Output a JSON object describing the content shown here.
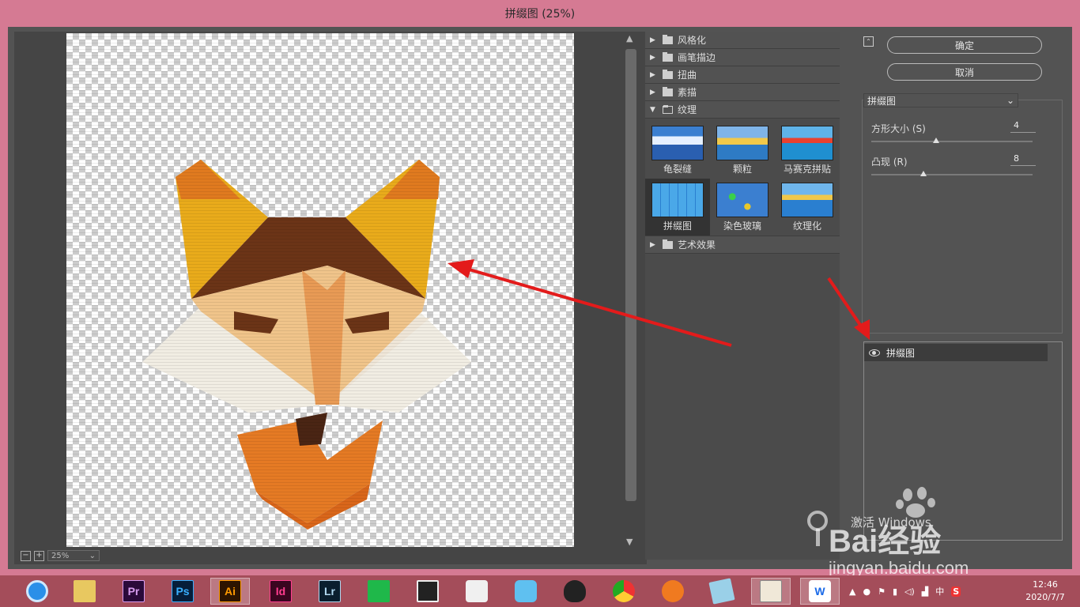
{
  "window": {
    "title": "拼缀图 (25%)"
  },
  "preview": {
    "zoom": "25%"
  },
  "gallery": {
    "categories_top": [
      {
        "label": "风格化",
        "expanded": false
      },
      {
        "label": "画笔描边",
        "expanded": false
      },
      {
        "label": "扭曲",
        "expanded": false
      },
      {
        "label": "素描",
        "expanded": false
      },
      {
        "label": "纹理",
        "expanded": true
      }
    ],
    "texture_thumbs": [
      {
        "label": "龟裂缝",
        "selected": false
      },
      {
        "label": "颗粒",
        "selected": false
      },
      {
        "label": "马赛克拼贴",
        "selected": false
      },
      {
        "label": "拼缀图",
        "selected": true
      },
      {
        "label": "染色玻璃",
        "selected": false
      },
      {
        "label": "纹理化",
        "selected": false
      }
    ],
    "category_bottom": {
      "label": "艺术效果",
      "expanded": false
    }
  },
  "panel": {
    "ok_label": "确定",
    "cancel_label": "取消",
    "filter_select": "拼缀图",
    "params": [
      {
        "label": "方形大小 (S)",
        "value": "4",
        "level": 0.4
      },
      {
        "label": "凸现 (R)",
        "value": "8",
        "level": 0.32
      }
    ],
    "layer_name": "拼缀图"
  },
  "watermark": {
    "activate": "激活 Windows",
    "brand": "Bai经验",
    "url": "jingyan.baidu.com"
  },
  "taskbar": {
    "apps": [
      "QQ浏览器",
      "文件资源管理器",
      "Pr",
      "Ps",
      "Ai",
      "Id",
      "Lr",
      "剪辑",
      "视频",
      "应用",
      "助手",
      "QQ",
      "Chrome",
      "Foxmail",
      "笔记",
      "画图",
      "W"
    ],
    "time": "12:46",
    "date": "2020/7/7",
    "ime": "中"
  },
  "colors": {
    "accent": "#d57a93",
    "dialog_bg": "#535353",
    "taskbar": "#a44d5a",
    "arrow": "#e31b1b"
  }
}
